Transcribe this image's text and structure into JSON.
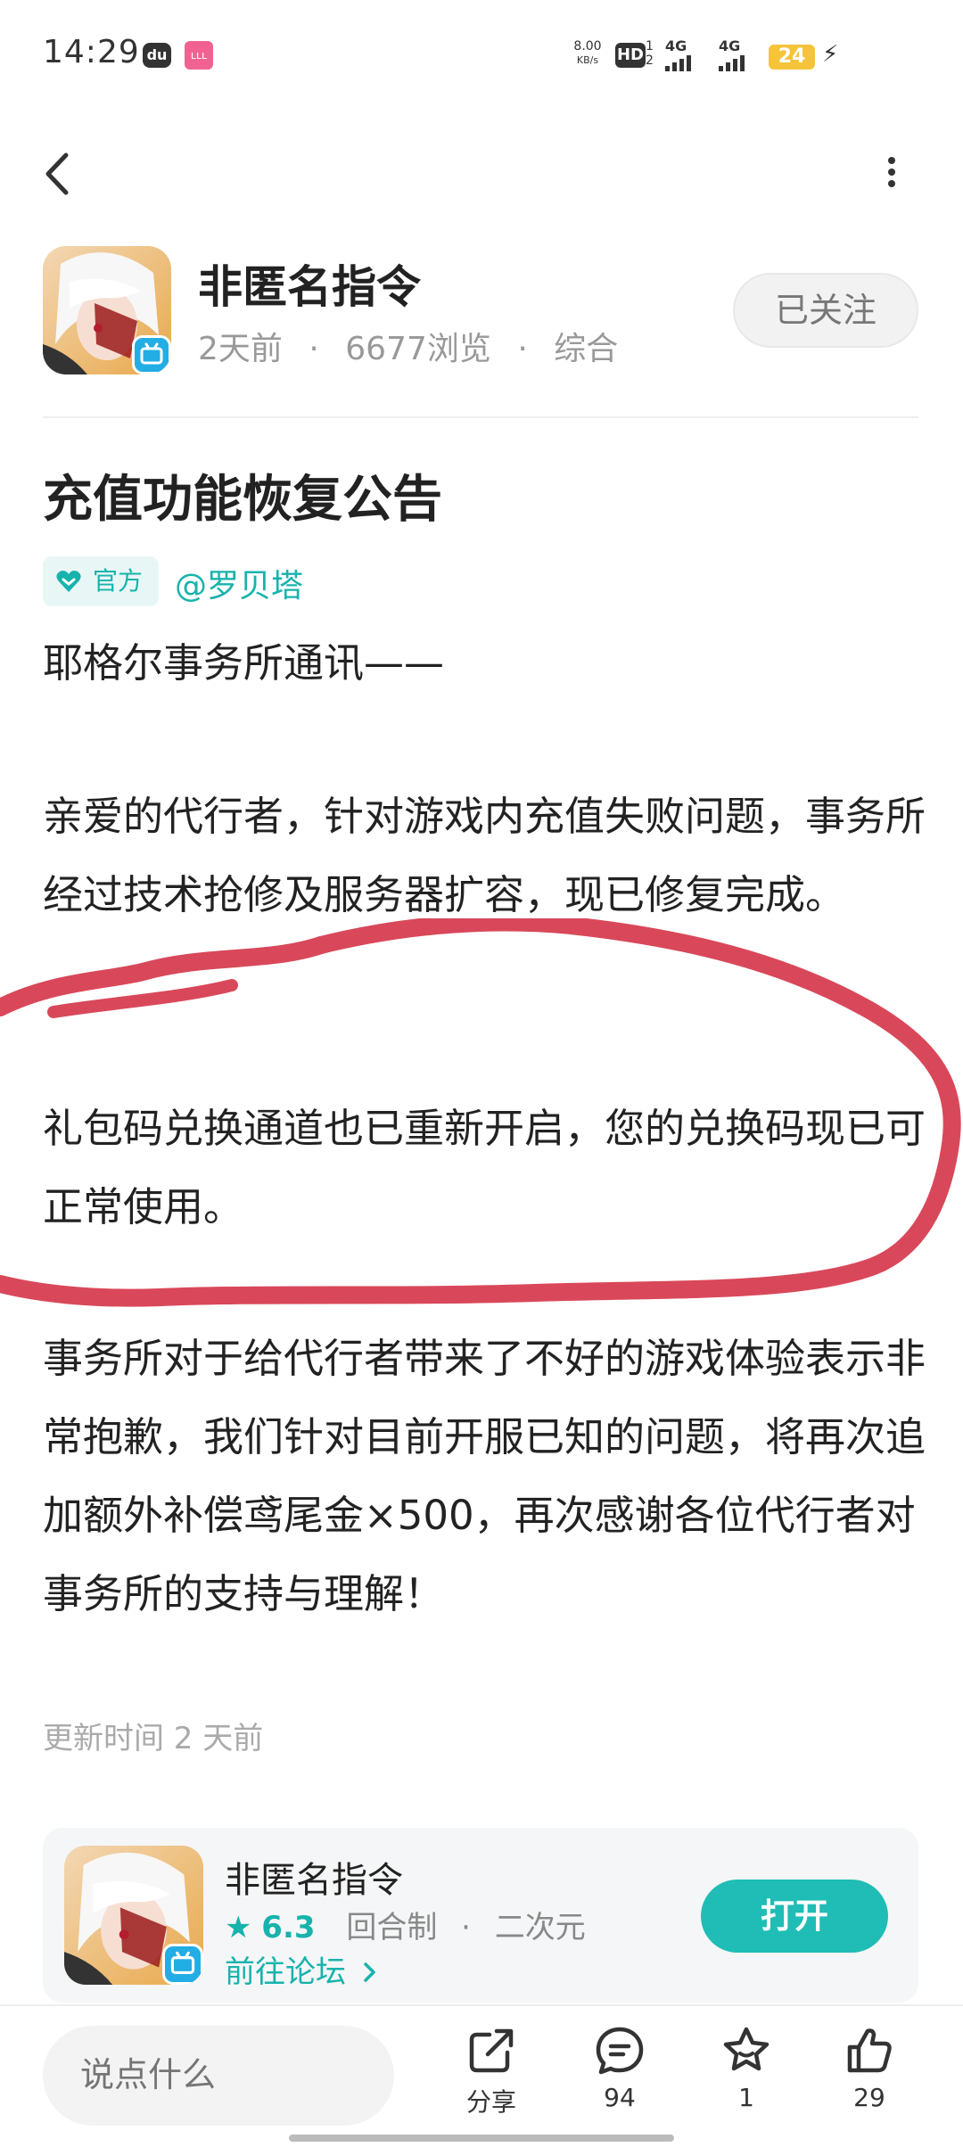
{
  "status_bar": {
    "time": "14:29",
    "app1_glyph": "du",
    "app2_glyph": "ʟʟʟ",
    "net_speed_value": "8.00",
    "net_speed_unit": "KB/s",
    "hd_label": "HD",
    "hd_sub1": "1",
    "hd_sub2": "2",
    "sim1_label": "4G",
    "sim2_label": "4G",
    "battery": "24",
    "icons": [
      "app-notification-icon",
      "app-notification-icon",
      "hd-voice-icon",
      "signal-icon",
      "signal-icon",
      "battery-icon",
      "charging-icon"
    ]
  },
  "nav": {
    "back_icon": "chevron-left-icon",
    "more_icon": "more-vertical-icon"
  },
  "author": {
    "name": "非匿名指令",
    "time_ago": "2天前",
    "views": "6677浏览",
    "category": "综合",
    "separator": "·",
    "follow_label": "已关注"
  },
  "post": {
    "title": "充值功能恢复公告",
    "official_label": "官方",
    "mention": "@罗贝塔",
    "paragraph1": "耶格尔事务所通讯——",
    "paragraph2": "亲爱的代行者，针对游戏内充值失败问题，事务所经过技术抢修及服务器扩容，现已修复完成。",
    "paragraph3": "礼包码兑换通道也已重新开启，您的兑换码现已可正常使用。",
    "paragraph4": "事务所对于给代行者带来了不好的游戏体验表示非常抱歉，我们针对目前开服已知的问题，将再次追加额外补偿鸢尾金×500，再次感谢各位代行者对事务所的支持与理解！",
    "update_time": "更新时间 2 天前"
  },
  "game_card": {
    "name": "非匿名指令",
    "rating": "6.3",
    "genre": "回合制",
    "style": "二次元",
    "separator": "·",
    "forum_link": "前往论坛",
    "open_label": "打开"
  },
  "bottom_bar": {
    "comment_placeholder": "说点什么",
    "share_label": "分享",
    "comments_count": "94",
    "favorites_count": "1",
    "likes_count": "29"
  },
  "colors": {
    "accent": "#1fbdb5",
    "scribble": "#d9485a",
    "text": "#222222",
    "muted": "#999999"
  }
}
